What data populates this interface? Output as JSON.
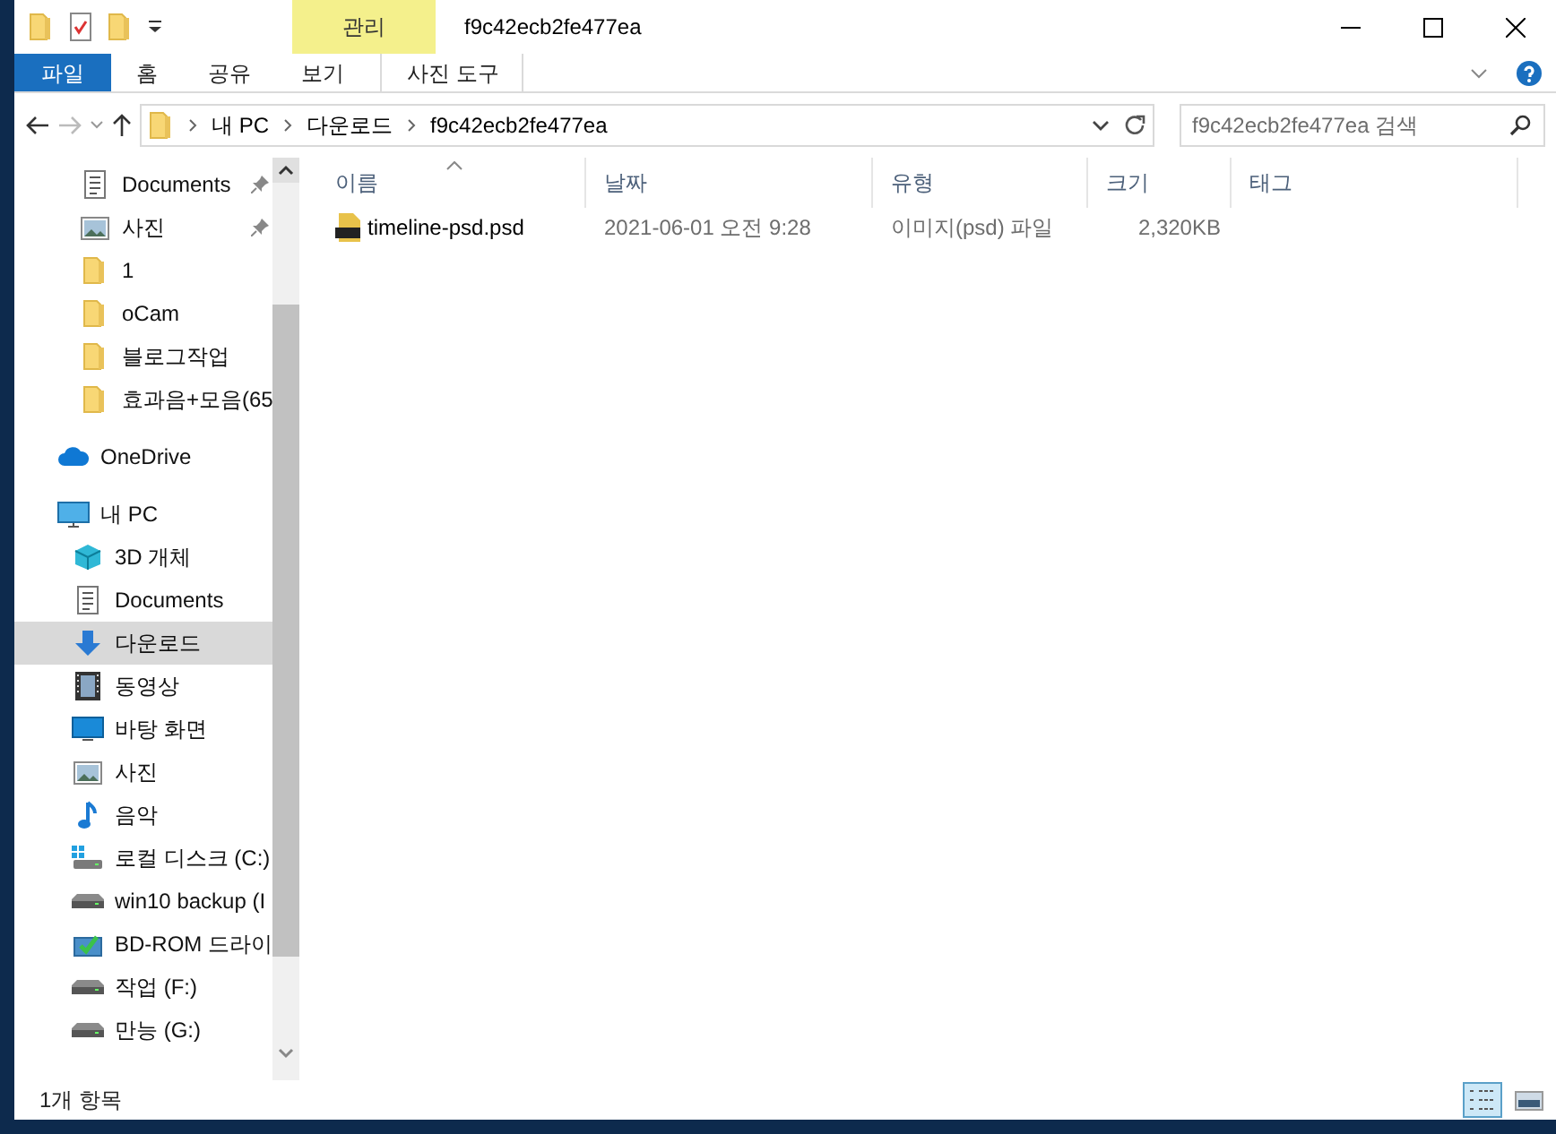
{
  "window": {
    "title": "f9c42ecb2fe477ea"
  },
  "contextual_tab": {
    "label": "관리"
  },
  "ribbon_tabs": [
    {
      "label": "파일",
      "kind": "file",
      "selected": false
    },
    {
      "label": "홈",
      "kind": "tab",
      "selected": false
    },
    {
      "label": "공유",
      "kind": "tab",
      "selected": false
    },
    {
      "label": "보기",
      "kind": "tab",
      "selected": false
    },
    {
      "label": "사진 도구",
      "kind": "context",
      "selected": false
    }
  ],
  "address": {
    "path": [
      "내 PC",
      "다운로드",
      "f9c42ecb2fe477ea"
    ]
  },
  "search": {
    "placeholder": "f9c42ecb2fe477ea 검색"
  },
  "nav": {
    "quick_access": [
      {
        "label": "Documents",
        "kind": "document",
        "pinned": true,
        "selected": false
      },
      {
        "label": "사진",
        "kind": "picture",
        "pinned": true,
        "selected": false
      },
      {
        "label": "1",
        "kind": "folder",
        "pinned": false,
        "selected": false
      },
      {
        "label": "oCam",
        "kind": "folder",
        "pinned": false,
        "selected": false
      },
      {
        "label": "블로그작업",
        "kind": "folder",
        "pinned": false,
        "selected": false
      },
      {
        "label": "효과음+모음(65",
        "kind": "folder",
        "pinned": false,
        "selected": false
      }
    ],
    "roots": [
      {
        "label": "OneDrive",
        "kind": "cloud",
        "selected": false
      },
      {
        "label": "내 PC",
        "kind": "pc",
        "selected": false,
        "children": [
          {
            "label": "3D 개체",
            "kind": "cube",
            "selected": false
          },
          {
            "label": "Documents",
            "kind": "document",
            "selected": false
          },
          {
            "label": "다운로드",
            "kind": "download",
            "selected": true
          },
          {
            "label": "동영상",
            "kind": "video",
            "selected": false
          },
          {
            "label": "바탕 화면",
            "kind": "desktop",
            "selected": false
          },
          {
            "label": "사진",
            "kind": "picture",
            "selected": false
          },
          {
            "label": "음악",
            "kind": "music",
            "selected": false
          },
          {
            "label": "로컬 디스크 (C:)",
            "kind": "sysdrive",
            "selected": false
          },
          {
            "label": "win10 backup (I",
            "kind": "drive",
            "selected": false
          },
          {
            "label": "BD-ROM 드라이",
            "kind": "bdrom",
            "selected": false
          },
          {
            "label": "작업 (F:)",
            "kind": "drive",
            "selected": false
          },
          {
            "label": "만능 (G:)",
            "kind": "drive",
            "selected": false
          }
        ]
      }
    ]
  },
  "columns": [
    {
      "label": "이름",
      "sorted": true
    },
    {
      "label": "날짜",
      "sorted": false
    },
    {
      "label": "유형",
      "sorted": false
    },
    {
      "label": "크기",
      "sorted": false
    },
    {
      "label": "태그",
      "sorted": false
    }
  ],
  "rows": [
    {
      "name": "timeline-psd.psd",
      "date": "2021-06-01 오전 9:28",
      "type": "이미지(psd) 파일",
      "size": "2,320KB"
    }
  ],
  "status_bar": {
    "text": "1개 항목"
  },
  "view_buttons": [
    {
      "kind": "details",
      "selected": true
    },
    {
      "kind": "thumbnails",
      "selected": false
    }
  ]
}
